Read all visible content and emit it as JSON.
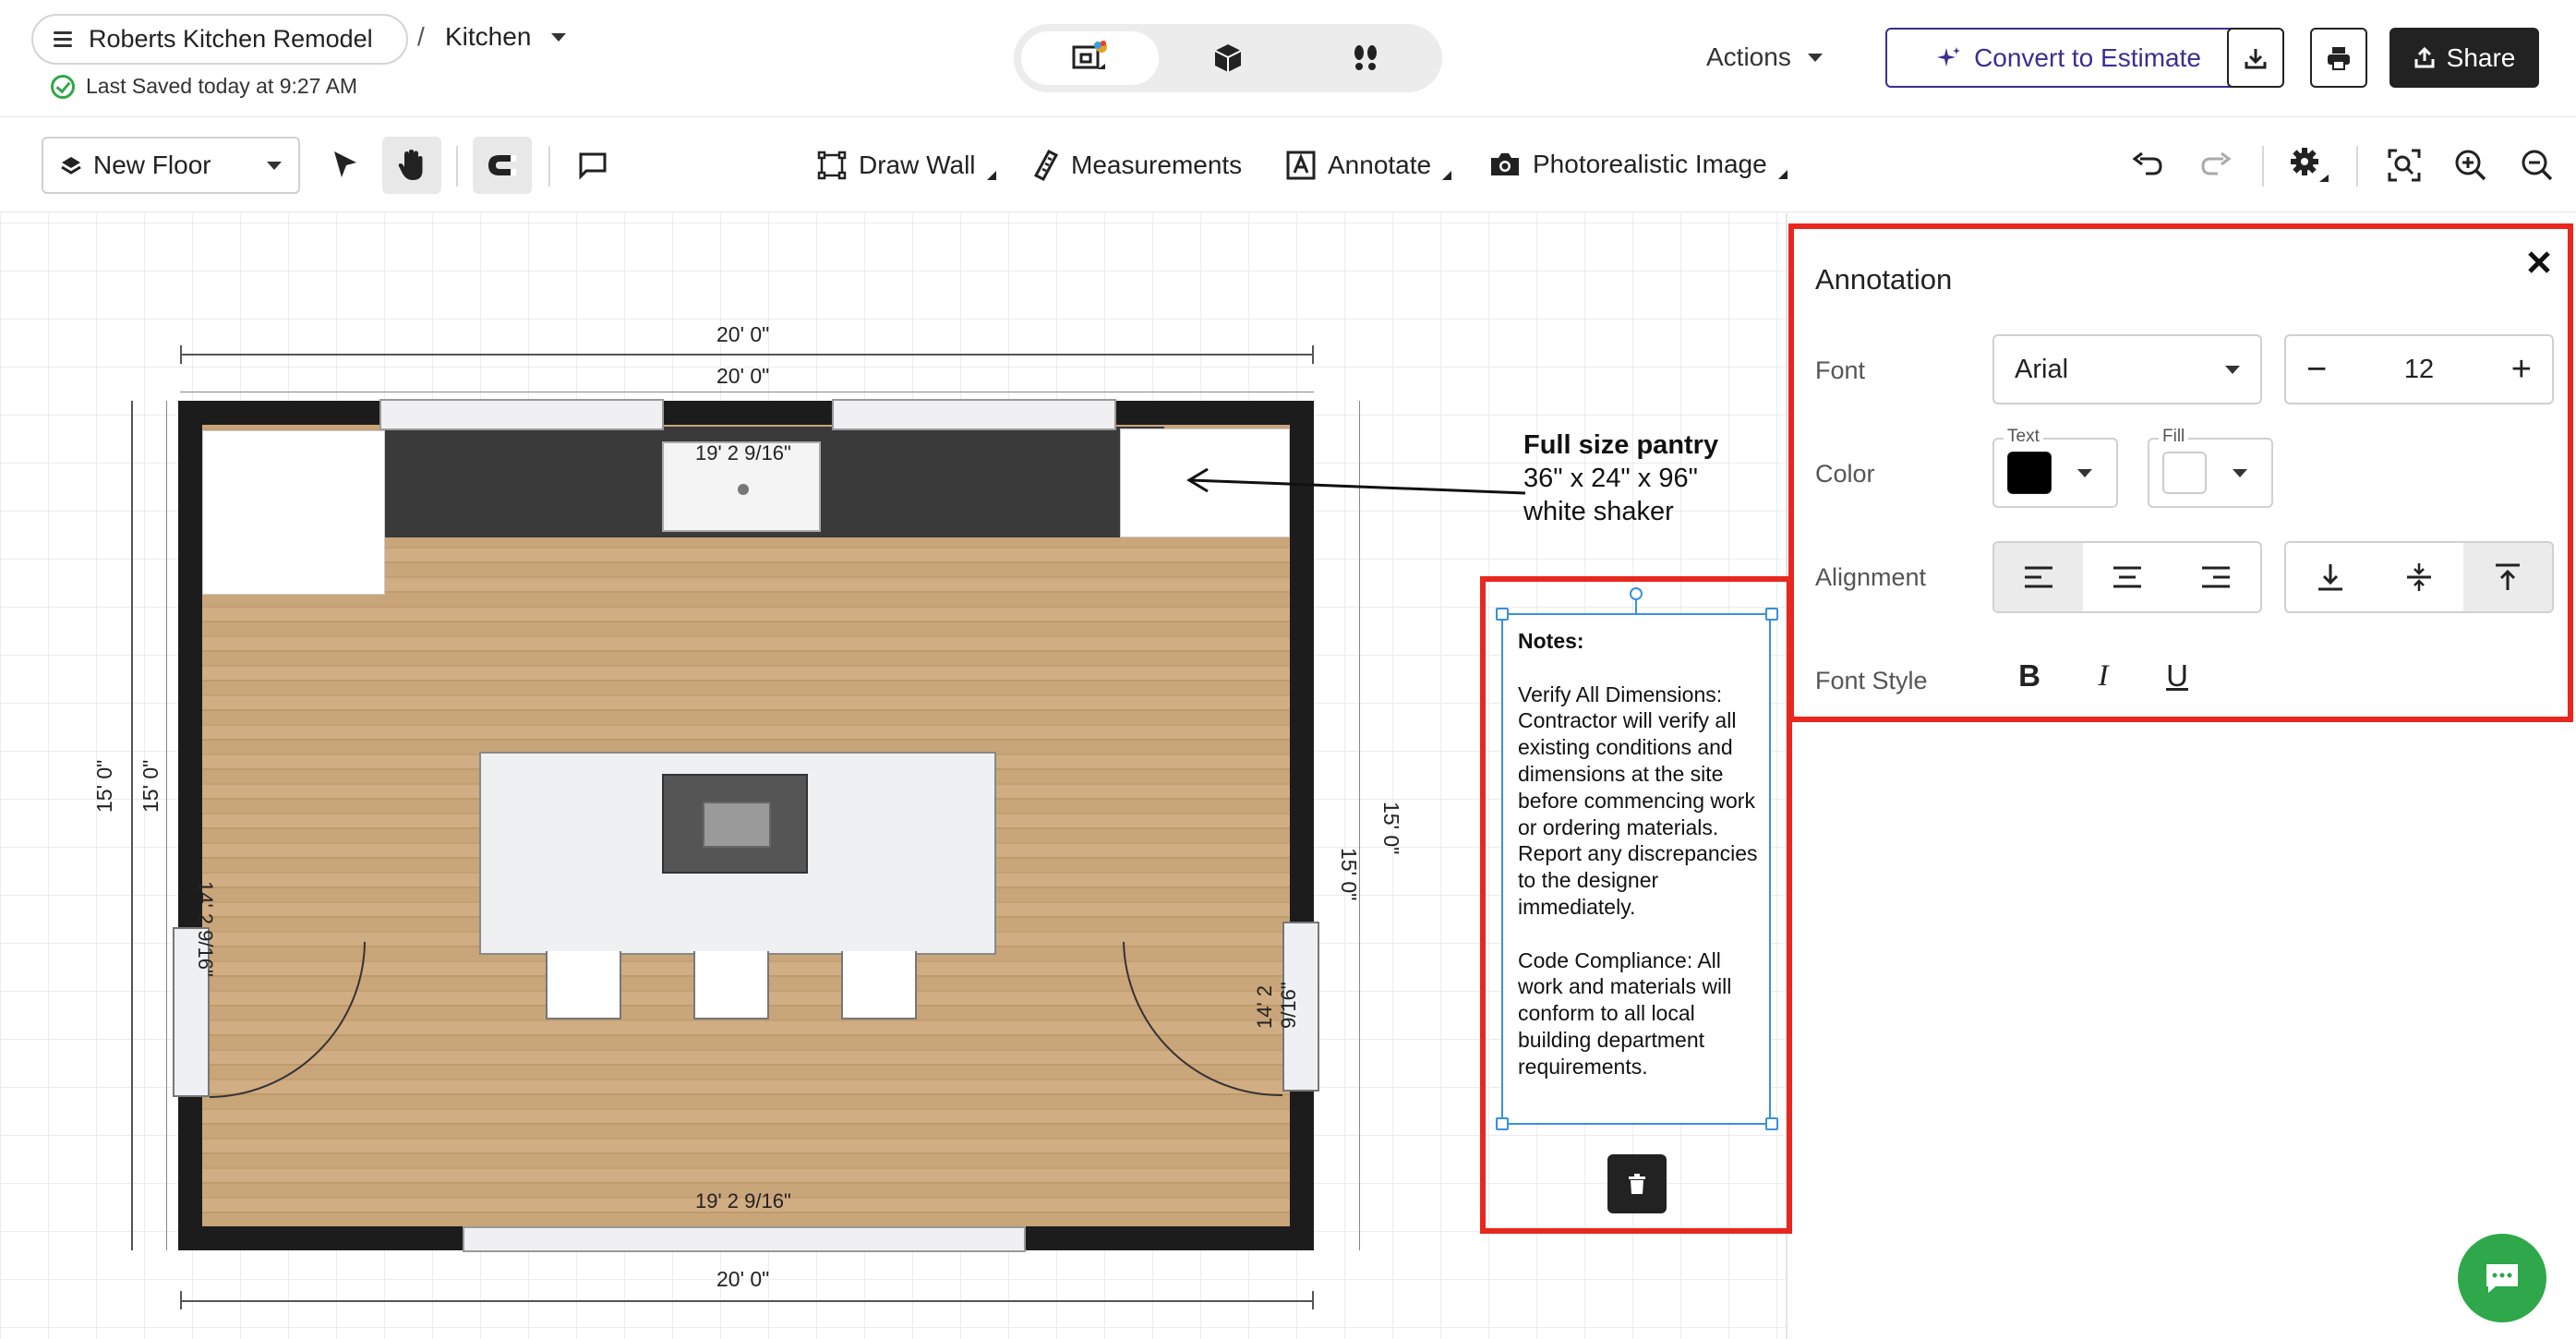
{
  "header": {
    "project_name": "Roberts Kitchen Remodel",
    "separator": "/",
    "room": "Kitchen",
    "saved_status": "Last Saved today at 9:27 AM",
    "view_modes": [
      "2d-floorplan",
      "3d-view",
      "walkthrough"
    ],
    "actions_label": "Actions",
    "convert_label": "Convert to Estimate",
    "share_label": "Share"
  },
  "toolbar": {
    "floor_label": "New Floor",
    "draw_wall": "Draw Wall",
    "measurements": "Measurements",
    "annotate": "Annotate",
    "photorealistic": "Photorealistic Image"
  },
  "plan": {
    "dim_top_outer": "20' 0\"",
    "dim_top_inner": "20' 0\"",
    "dim_bottom_outer": "20' 0\"",
    "dim_bottom_inner": "19' 2 9/16\"",
    "dim_top_inside": "19' 2 9/16\"",
    "dim_left_outer": "15' 0\"",
    "dim_left_mid": "15' 0\"",
    "dim_left_inner": "14' 2 9/16\"",
    "dim_right_inner": "14' 2 9/16\"",
    "dim_right_mid": "15' 0\"",
    "dim_right_outer": "15' 0\""
  },
  "annotations": {
    "pantry_title": "Full size pantry",
    "pantry_line2": "36\" x 24\" x 96\"",
    "pantry_line3": "white shaker",
    "notes_title": "Notes:",
    "notes_body": "Verify All Dimensions: Contractor will verify all existing conditions and dimensions at the site before commencing work or ordering materials. Report any discrepancies to the designer immediately.\n\nCode Compliance: All work and materials will conform to all local building department requirements."
  },
  "panel": {
    "title": "Annotation",
    "font_label": "Font",
    "font_value": "Arial",
    "size_value": "12",
    "size_minus": "−",
    "size_plus": "+",
    "color_label": "Color",
    "text_label": "Text",
    "fill_label": "Fill",
    "text_color": "#000000",
    "fill_color": "#ffffff",
    "alignment_label": "Alignment",
    "horizontal_selected": "left",
    "vertical_selected": "top",
    "font_style_label": "Font Style",
    "bold": "B",
    "italic": "I",
    "underline": "U"
  },
  "colors": {
    "accent": "#3a2f8f",
    "highlight": "#e8281e",
    "success": "#2ea84a",
    "selection": "#3a8fe0"
  }
}
